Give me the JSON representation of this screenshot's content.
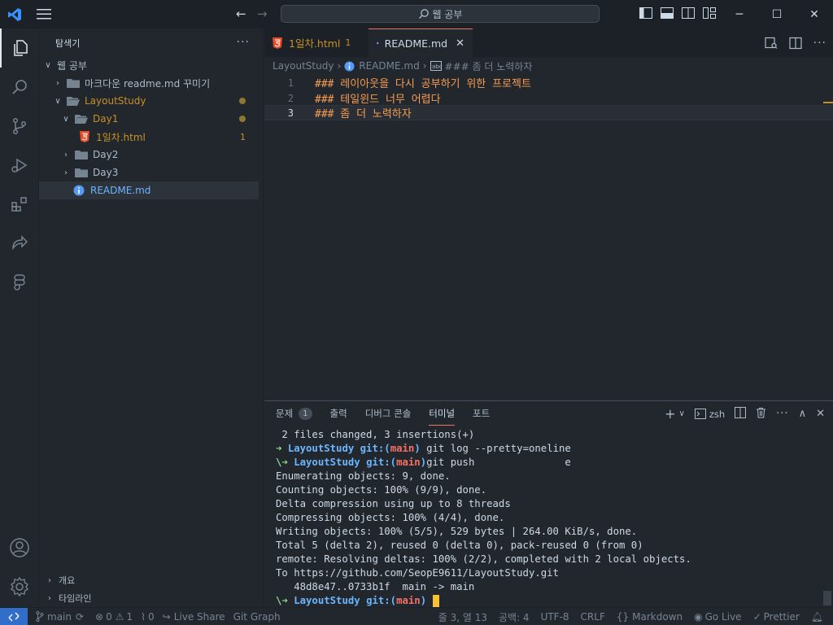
{
  "titlebar": {
    "search_label": "웹 공부",
    "win_minimize": "─",
    "win_maximize": "☐",
    "win_close": "✕"
  },
  "sidebar": {
    "title": "탐색기",
    "root": "웹 공부",
    "items": [
      {
        "label": "마크다운 readme.md 꾸미기"
      },
      {
        "label": "LayoutStudy"
      },
      {
        "label": "Day1"
      },
      {
        "label": "1일차.html",
        "badge": "1"
      },
      {
        "label": "Day2"
      },
      {
        "label": "Day3"
      },
      {
        "label": "README.md"
      }
    ],
    "outline_label": "개요",
    "timeline_label": "타임라인"
  },
  "tabs": [
    {
      "label": "1일차.html",
      "badge": "1"
    },
    {
      "label": "README.md"
    }
  ],
  "breadcrumb": {
    "folder": "LayoutStudy",
    "file": "README.md",
    "symbol": "### 좀 더 노력하자"
  },
  "editor": {
    "lines": [
      {
        "no": "1",
        "text": "### 레이아웃을 다시 공부하기 위한 프로젝트"
      },
      {
        "no": "2",
        "text": "### 테일윈드 너무 어렵다"
      },
      {
        "no": "3",
        "text": "### 좀 더 노력하자"
      }
    ]
  },
  "panel": {
    "tabs": [
      {
        "label": "문제",
        "badge": "1"
      },
      {
        "label": "출력"
      },
      {
        "label": "디버그 콘솔"
      },
      {
        "label": "터미널"
      },
      {
        "label": "포트"
      }
    ],
    "shell": "zsh",
    "terminal": {
      "line0": " 2 files changed, 3 insertions(+)",
      "prompt_arrow": "➜",
      "prompt_esc_arrow": "\\➜",
      "prompt_dir": "LayoutStudy",
      "prompt_git": "git:(",
      "prompt_branch": "main",
      "prompt_close": ")",
      "cmd1": " git log --pretty=oneline",
      "cmd2": "git push               e",
      "output": [
        "Enumerating objects: 9, done.",
        "Counting objects: 100% (9/9), done.",
        "Delta compression using up to 8 threads",
        "Compressing objects: 100% (4/4), done.",
        "Writing objects: 100% (5/5), 529 bytes | 264.00 KiB/s, done.",
        "Total 5 (delta 2), reused 0 (delta 0), pack-reused 0 (from 0)",
        "remote: Resolving deltas: 100% (2/2), completed with 2 local objects.",
        "To https://github.com/SeopE9611/LayoutStudy.git",
        "   48d8e47..0733b1f  main -> main"
      ]
    }
  },
  "statusbar": {
    "branch": "main",
    "errors": "0",
    "warnings": "1",
    "ports": "0",
    "live_share": "Live Share",
    "git_graph": "Git Graph",
    "cursor_pos": "줄 3, 열 13",
    "spaces": "공백: 4",
    "encoding": "UTF-8",
    "eol": "CRLF",
    "language": "Markdown",
    "go_live": "Go Live",
    "prettier": "Prettier"
  },
  "colors": {
    "accent": "#316dca",
    "tab_highlight": "#ec775c",
    "code_heading": "#f69d50",
    "warning": "#c69026"
  }
}
